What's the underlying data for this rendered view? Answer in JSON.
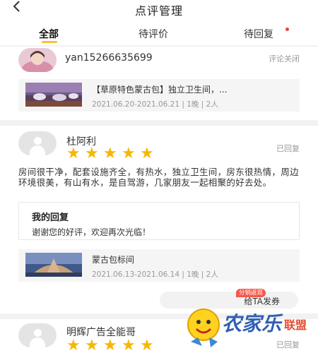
{
  "header": {
    "title": "点评管理",
    "back_icon": "chevron-left-icon"
  },
  "tabs": [
    {
      "label": "全部",
      "active": true
    },
    {
      "label": "待评价",
      "active": false
    },
    {
      "label": "待回复",
      "active": false,
      "badge_dot": true
    }
  ],
  "reviews": [
    {
      "user": "yan15266635699",
      "status": "评论关闭",
      "product": {
        "title": "【草原特色蒙古包】独立卫生间，...",
        "meta": "2021.06.20-2021.06.21 | 1晚 | 2人"
      }
    },
    {
      "user": "杜阿利",
      "rating": 5,
      "status": "已回复",
      "text": "房间很干净，配套设施齐全，有热水，独立卫生间，房东很热情，周边环境很美，有山有水，是自驾游，几家朋友一起相聚的好去处。",
      "reply": {
        "title": "我的回复",
        "text": "谢谢您的好评，欢迎再次光临！"
      },
      "product": {
        "title": "蒙古包标间",
        "meta": "2021.06.13-2021.06.14 | 1晚 | 2人"
      },
      "promo": {
        "label": "给TA发券",
        "tag": "分销返现"
      }
    },
    {
      "user": "明辉广告全能哥",
      "rating": 5,
      "status": "已回复"
    }
  ],
  "watermark": {
    "text": "农家乐联盟"
  },
  "colors": {
    "accent": "#f6c23a",
    "star": "#f5b800",
    "badge": "#e64340",
    "tag": "#f25a4a"
  }
}
